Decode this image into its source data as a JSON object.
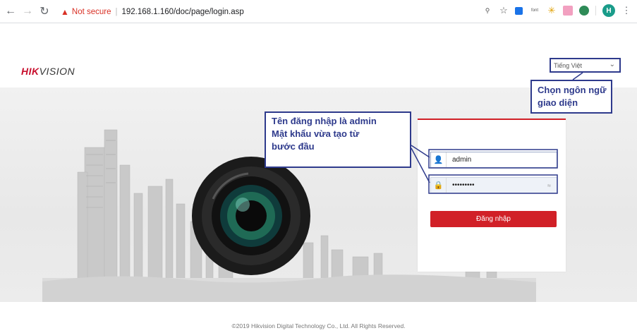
{
  "browser": {
    "security_label": "Not secure",
    "url": "192.168.1.160/doc/page/login.asp",
    "profile_initial": "H",
    "ext_font_label": "font"
  },
  "header": {
    "logo_part1": "HIK",
    "logo_part2": "VISION",
    "language_selected": "Tiếng Việt"
  },
  "login": {
    "username_value": "admin",
    "password_masked": "•••••••••",
    "login_button": "Đăng nhập"
  },
  "annotations": {
    "credentials_lines": [
      "Tên đăng nhập là admin",
      "Mật khẩu vừa tạo từ",
      "bước đầu"
    ],
    "language_lines": [
      "Chọn ngôn ngữ",
      "giao diện"
    ]
  },
  "footer": {
    "copyright": "©2019 Hikvision Digital Technology Co., Ltd. All Rights Reserved."
  },
  "colors": {
    "brand_red": "#d12027",
    "annotation_blue": "#2e3a8c"
  }
}
